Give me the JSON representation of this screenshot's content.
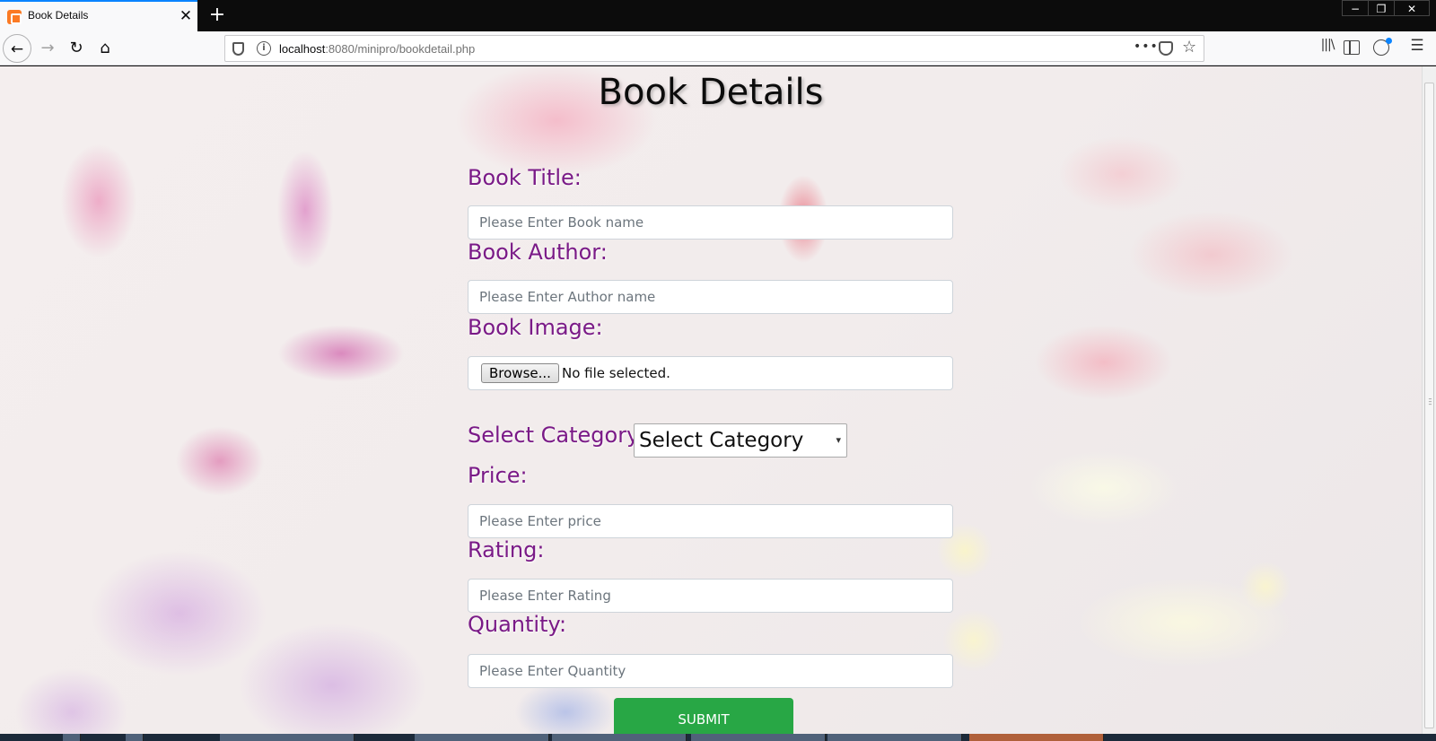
{
  "browser": {
    "tab_title": "Book Details",
    "tab_close": "✕",
    "new_tab": "+",
    "window_min": "−",
    "window_max": "❐",
    "window_close": "✕",
    "nav_back": "←",
    "nav_forward": "→",
    "nav_reload": "↻",
    "nav_home": "⌂",
    "url_host": "localhost",
    "url_path": ":8080/minipro/bookdetail.php",
    "page_actions": "•••",
    "bookmark_star": "☆",
    "library": "|||\\",
    "menu": "☰",
    "info": "i",
    "accent_color": "#0a84ff"
  },
  "page": {
    "title": "Book Details",
    "label_color": "#7a1a87",
    "fields": {
      "book_title": {
        "label": "Book Title:",
        "placeholder": "Please Enter Book name"
      },
      "book_author": {
        "label": "Book Author:",
        "placeholder": "Please Enter Author name"
      },
      "book_image": {
        "label": "Book Image:",
        "browse_label": "Browse...",
        "status": "No file selected."
      },
      "category": {
        "label": "Select Category:",
        "selected": "Select Category",
        "caret": "▾"
      },
      "price": {
        "label": "Price:",
        "placeholder": "Please Enter price"
      },
      "rating": {
        "label": "Rating:",
        "placeholder": "Please Enter Rating"
      },
      "quantity": {
        "label": "Quantity:",
        "placeholder": "Please Enter Quantity"
      }
    },
    "submit_label": "SUBMIT",
    "submit_color": "#28a745"
  }
}
